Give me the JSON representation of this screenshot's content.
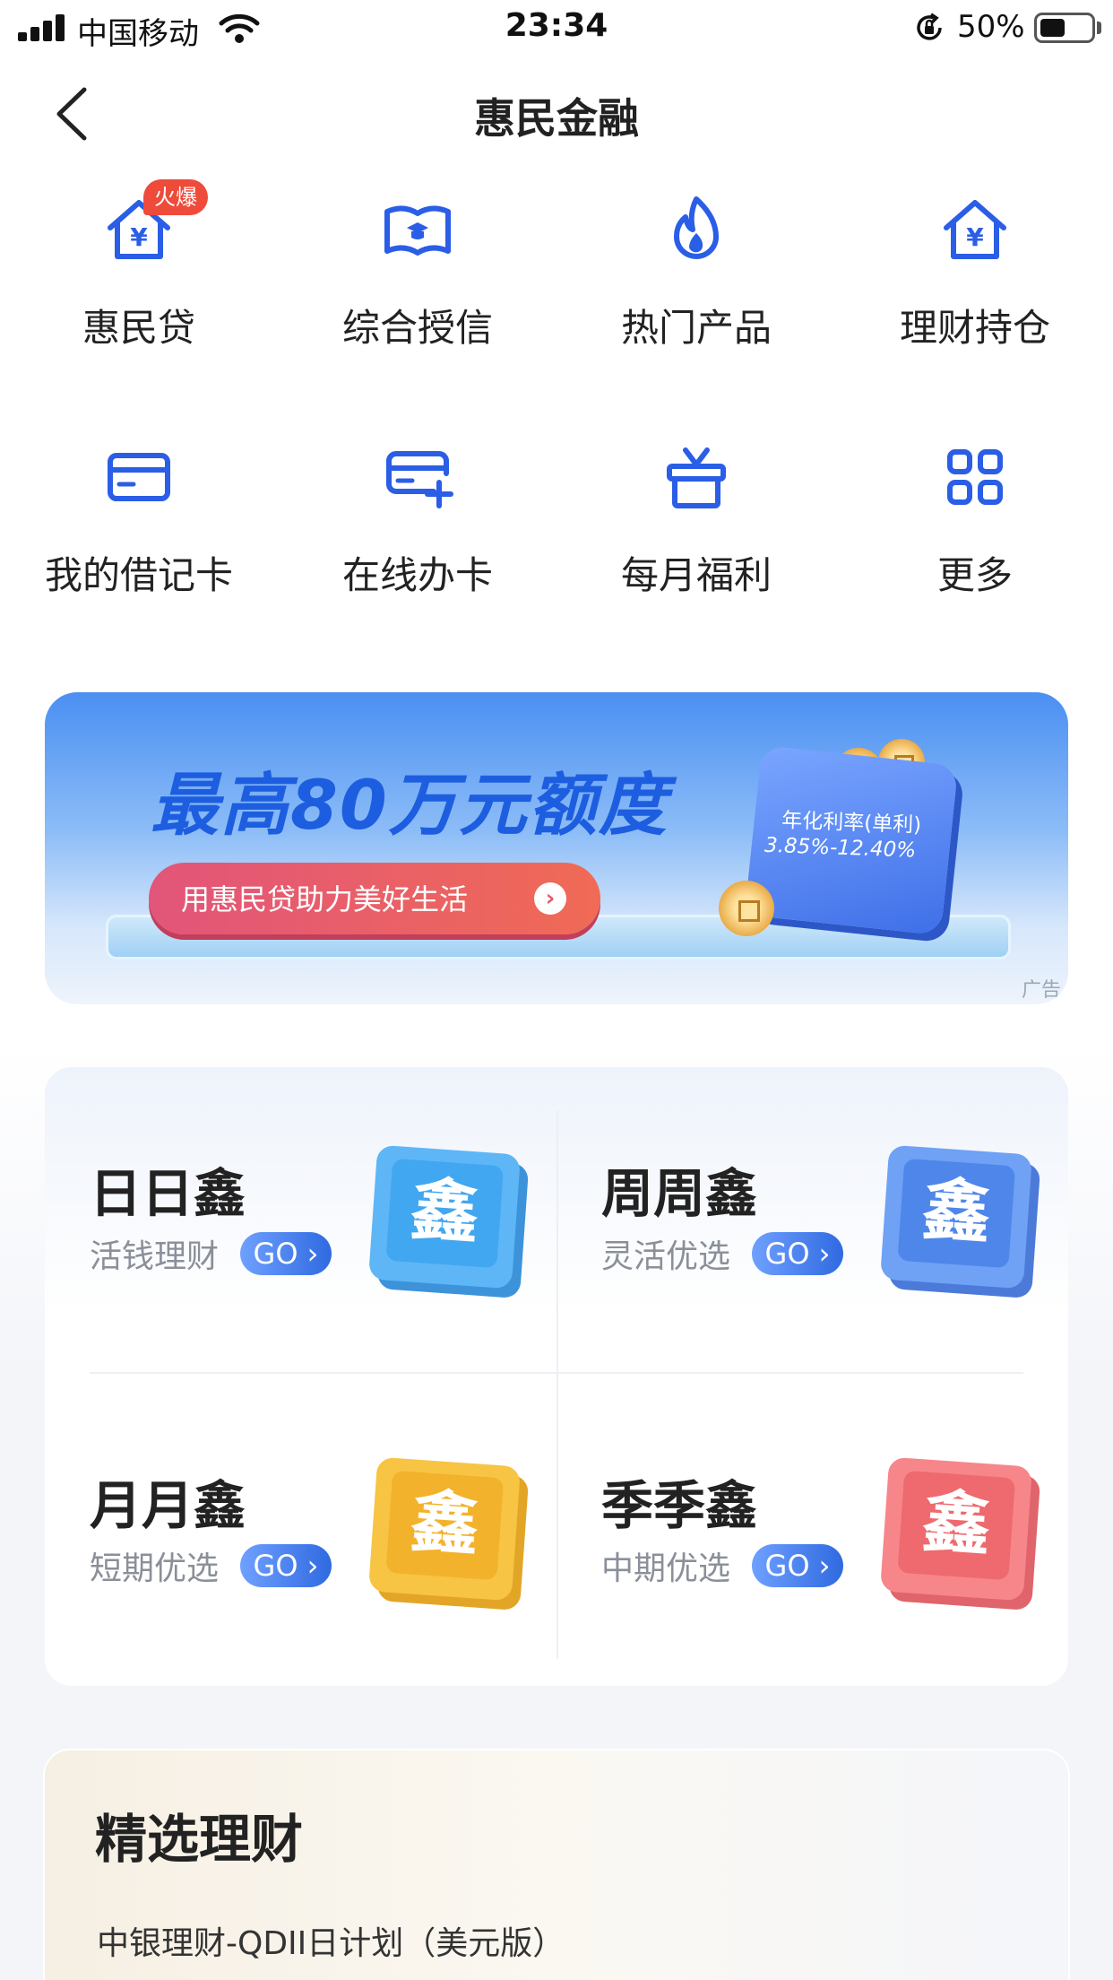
{
  "status_bar": {
    "carrier": "中国移动",
    "time": "23:34",
    "battery_percent": "50%",
    "battery_level": 0.5
  },
  "nav": {
    "title": "惠民金融"
  },
  "grid": [
    {
      "label": "惠民贷",
      "icon": "house-yuan-icon",
      "badge": "火爆"
    },
    {
      "label": "综合授信",
      "icon": "book-grad-icon"
    },
    {
      "label": "热门产品",
      "icon": "flame-icon"
    },
    {
      "label": "理财持仓",
      "icon": "house-yuan-icon"
    },
    {
      "label": "我的借记卡",
      "icon": "card-icon"
    },
    {
      "label": "在线办卡",
      "icon": "card-add-icon"
    },
    {
      "label": "每月福利",
      "icon": "gift-icon"
    },
    {
      "label": "更多",
      "icon": "grid-more-icon"
    }
  ],
  "banner": {
    "title": "最高80万元额度",
    "button_label": "用惠民贷助力美好生活",
    "rate_title": "年化利率(单利)",
    "rate_value": "3.85%-12.40%",
    "ad_label": "广告"
  },
  "xin_products": [
    {
      "name": "日日鑫",
      "desc": "活钱理财",
      "go": "GO",
      "tile_char": "鑫",
      "tile_color": "#41a7f0"
    },
    {
      "name": "周周鑫",
      "desc": "灵活优选",
      "go": "GO",
      "tile_char": "鑫",
      "tile_color": "#4f86ea"
    },
    {
      "name": "月月鑫",
      "desc": "短期优选",
      "go": "GO",
      "tile_char": "鑫",
      "tile_color": "#f2b22b"
    },
    {
      "name": "季季鑫",
      "desc": "中期优选",
      "go": "GO",
      "tile_char": "鑫",
      "tile_color": "#ee6a6e"
    }
  ],
  "selected_finance": {
    "title": "精选理财",
    "product": "中银理财-QDII日计划（美元版）"
  },
  "colors": {
    "accent": "#2b5ee6",
    "hot_badge": "#ee4b3a"
  }
}
